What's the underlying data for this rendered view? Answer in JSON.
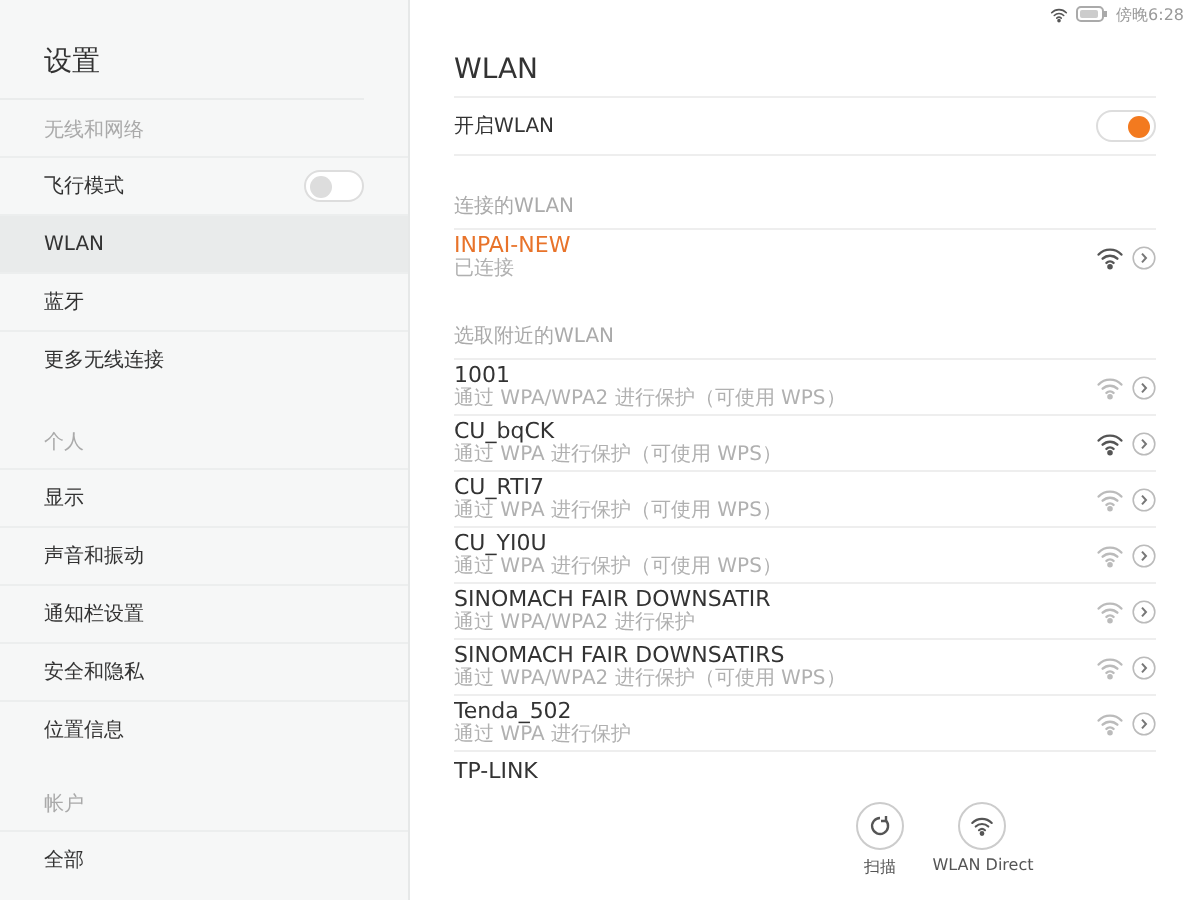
{
  "sidebar": {
    "title": "设置",
    "sections": [
      {
        "header": "无线和网络",
        "items": [
          {
            "label": "飞行模式",
            "selected": false,
            "toggle": {
              "on": false
            }
          },
          {
            "label": "WLAN",
            "selected": true
          },
          {
            "label": "蓝牙",
            "selected": false
          },
          {
            "label": "更多无线连接",
            "selected": false
          }
        ]
      },
      {
        "header": "个人",
        "items": [
          {
            "label": "显示",
            "selected": false
          },
          {
            "label": "声音和振动",
            "selected": false
          },
          {
            "label": "通知栏设置",
            "selected": false
          },
          {
            "label": "安全和隐私",
            "selected": false
          },
          {
            "label": "位置信息",
            "selected": false
          }
        ]
      },
      {
        "header": "帐户",
        "items": [
          {
            "label": "全部",
            "selected": false
          }
        ]
      }
    ]
  },
  "status_bar": {
    "time": "傍晚6:28"
  },
  "page": {
    "title": "WLAN",
    "wlan_switch": {
      "label": "开启WLAN",
      "on": true
    },
    "connected": {
      "header": "连接的WLAN",
      "networks": [
        {
          "name": "INPAI-NEW",
          "detail": "已连接",
          "connected": true,
          "strong": true
        }
      ]
    },
    "nearby": {
      "header": "选取附近的WLAN",
      "networks": [
        {
          "name": "1001",
          "detail": "通过 WPA/WPA2 进行保护（可使用 WPS）",
          "connected": false,
          "strong": false
        },
        {
          "name": "CU_bqCK",
          "detail": "通过 WPA 进行保护（可使用 WPS）",
          "connected": false,
          "strong": true
        },
        {
          "name": "CU_RTI7",
          "detail": "通过 WPA 进行保护（可使用 WPS）",
          "connected": false,
          "strong": false
        },
        {
          "name": "CU_YI0U",
          "detail": "通过 WPA 进行保护（可使用 WPS）",
          "connected": false,
          "strong": false
        },
        {
          "name": "SINOMACH FAIR DOWNSATIR",
          "detail": "通过 WPA/WPA2 进行保护",
          "connected": false,
          "strong": false
        },
        {
          "name": "SINOMACH FAIR DOWNSATIRS",
          "detail": "通过 WPA/WPA2 进行保护（可使用 WPS）",
          "connected": false,
          "strong": false
        },
        {
          "name": "Tenda_502",
          "detail": "通过 WPA 进行保护",
          "connected": false,
          "strong": false
        },
        {
          "name": "TP-LINK",
          "connected": false
        }
      ]
    },
    "actions": [
      {
        "kind": "scan",
        "label": "扫描"
      },
      {
        "kind": "direct",
        "label": "WLAN Direct"
      }
    ]
  }
}
